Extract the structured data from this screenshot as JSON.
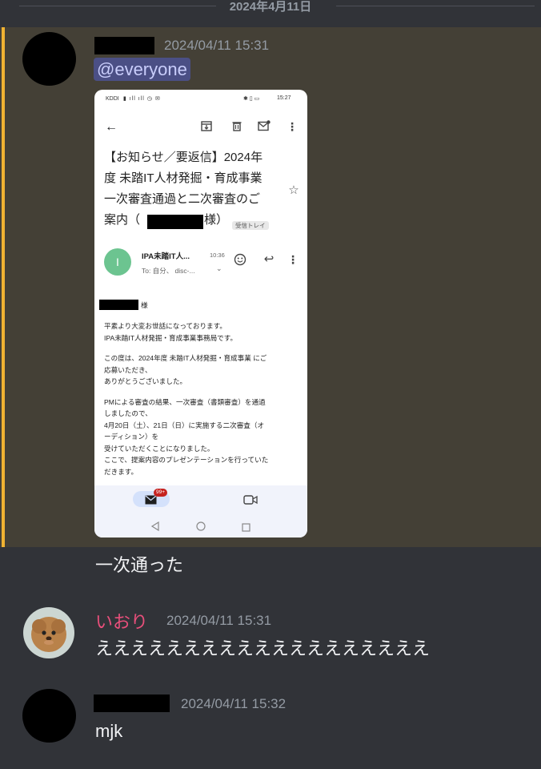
{
  "date_divider": "2024年4月11日",
  "messages": [
    {
      "timestamp": "2024/04/11 15:31",
      "mention": "@everyone",
      "text": "一次通った",
      "attachment": {
        "status_bar": {
          "carrier": "KDDI",
          "time": "15:27"
        },
        "subject": [
          "【お知らせ／要返信】2024年",
          "度 未踏IT人材発掘・育成事業",
          "一次審査通過と二次審査のご",
          "案内（",
          "様）"
        ],
        "label_tag": "受信トレイ",
        "sender_initial": "I",
        "sender_name": "IPA未踏IT人...",
        "sender_time": "10:36",
        "sender_to": "To: 自分、 disc-...",
        "salutation_suffix": "様",
        "body": [
          "平素より大変お世話になっております。",
          "IPA未踏IT人材発掘・育成事業事務局です。",
          "",
          "この度は、2024年度 未踏IT人材発掘・育成事業 にご",
          "応募いただき、",
          "ありがとうございました。",
          "",
          "PMによる審査の結果、一次審査（書類審査）を通過",
          "しましたので、",
          "4月20日（土）、21日（日）に実施する二次審査（オ",
          "ーディション）を",
          "受けていただくことになりました。",
          "ここで、提案内容のプレゼンテーションを行っていた",
          "だきます。"
        ],
        "badge": "99+"
      }
    },
    {
      "author": "いおり",
      "author_color": "#e94f7b",
      "timestamp": "2024/04/11 15:31",
      "text": "えええええええええええええええええええ"
    },
    {
      "timestamp": "2024/04/11 15:32",
      "text": "mjk"
    }
  ]
}
